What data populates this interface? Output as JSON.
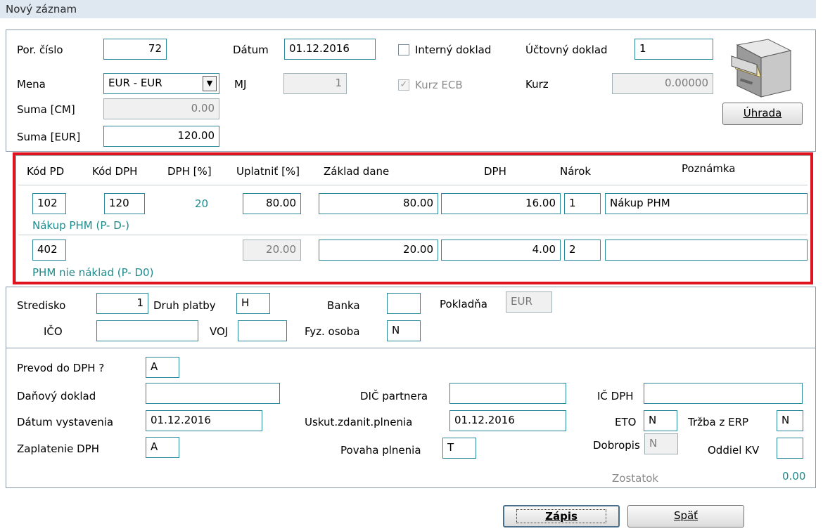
{
  "window": {
    "title": "Nový záznam"
  },
  "header": {
    "por_cislo": {
      "label": "Por. číslo",
      "value": "72"
    },
    "datum": {
      "label": "Dátum",
      "value": "01.12.2016"
    },
    "interny": {
      "label": "Interný doklad",
      "checked": false
    },
    "uctovny": {
      "label": "Účtovný doklad",
      "value": "1"
    },
    "mena": {
      "label": "Mena",
      "value": "EUR - EUR"
    },
    "mj": {
      "label": "MJ",
      "value": "1"
    },
    "kurz_ecb": {
      "label": "Kurz ECB",
      "checked": true
    },
    "kurz": {
      "label": "Kurz",
      "value": "0.00000"
    },
    "suma_cm": {
      "label": "Suma [CM]",
      "value": "0.00"
    },
    "suma_eur": {
      "label": "Suma [EUR]",
      "value": "120.00"
    },
    "uhrada_button": "Úhrada"
  },
  "vat": {
    "columns": [
      "Kód PD",
      "Kód DPH",
      "DPH [%]",
      "Uplatniť [%]",
      "Základ dane",
      "DPH",
      "Nárok",
      "Poznámka"
    ],
    "rows": [
      {
        "kod_pd": "102",
        "kod_dph": "120",
        "dph_pct": "20",
        "uplatnit": "80.00",
        "zaklad": "80.00",
        "dph": "16.00",
        "narok": "1",
        "poznamka": "Nákup PHM",
        "desc": "Nákup PHM (P- D-)"
      },
      {
        "kod_pd": "402",
        "kod_dph": "",
        "dph_pct": "",
        "uplatnit": "20.00",
        "zaklad": "20.00",
        "dph": "4.00",
        "narok": "2",
        "poznamka": "",
        "desc": "PHM nie náklad (P- D0)"
      }
    ]
  },
  "middle": {
    "stredisko": {
      "label": "Stredisko",
      "value": "1"
    },
    "druh_platby": {
      "label": "Druh platby",
      "value": "H"
    },
    "banka": {
      "label": "Banka",
      "value": ""
    },
    "pokladna": {
      "label": "Pokladňa",
      "value": "EUR"
    },
    "ico": {
      "label": "IČO",
      "value": ""
    },
    "voj": {
      "label": "VOJ",
      "value": ""
    },
    "fyz_osoba": {
      "label": "Fyz. osoba",
      "value": "N"
    }
  },
  "bottom": {
    "prevod": {
      "label": "Prevod do DPH ?",
      "value": "A"
    },
    "danovy": {
      "label": "Daňový doklad",
      "value": ""
    },
    "dic_partnera": {
      "label": "DIČ partnera",
      "value": ""
    },
    "ic_dph": {
      "label": "IČ DPH",
      "value": ""
    },
    "datum_vyst": {
      "label": "Dátum vystavenia",
      "value": "01.12.2016"
    },
    "uskut": {
      "label": "Uskut.zdanit.plnenia",
      "value": "01.12.2016"
    },
    "eto": {
      "label": "ETO",
      "value": "N"
    },
    "trzba": {
      "label": "Tržba z ERP",
      "value": "N"
    },
    "zaplatenie": {
      "label": "Zaplatenie DPH",
      "value": "A"
    },
    "povaha": {
      "label": "Povaha plnenia",
      "value": "T"
    },
    "dobropis": {
      "label": "Dobropis",
      "value": "N"
    },
    "oddiel": {
      "label": "Oddiel KV",
      "value": ""
    },
    "zostatok": {
      "label": "Zostatok",
      "value": "0.00"
    }
  },
  "buttons": {
    "zapis": "Zápis",
    "spat": "Späť"
  }
}
